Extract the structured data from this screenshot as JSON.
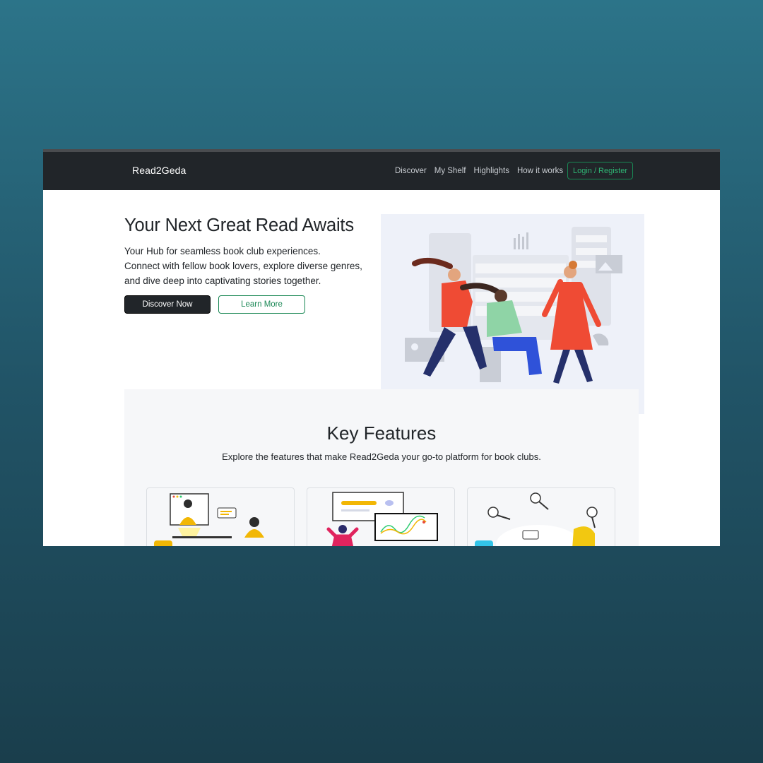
{
  "navbar": {
    "brand": "Read2Geda",
    "links": [
      "Discover",
      "My Shelf",
      "Highlights",
      "How it works"
    ],
    "login_label": "Login / Register"
  },
  "hero": {
    "title": "Your Next Great Read Awaits",
    "lines": [
      "Your Hub for seamless book club experiences.",
      "Connect with fellow book lovers, explore diverse genres,",
      "and dive deep into captivating stories together."
    ],
    "primary_button": "Discover Now",
    "secondary_button": "Learn More"
  },
  "features": {
    "title": "Key Features",
    "subtitle": "Explore the features that make Read2Geda your go-to platform for book clubs."
  },
  "colors": {
    "page_background_top": "#2c7489",
    "page_background_bottom": "#1a3e4c",
    "navbar": "#212529",
    "accent_green": "#198754",
    "illustration_bg": "#eef1f9"
  }
}
